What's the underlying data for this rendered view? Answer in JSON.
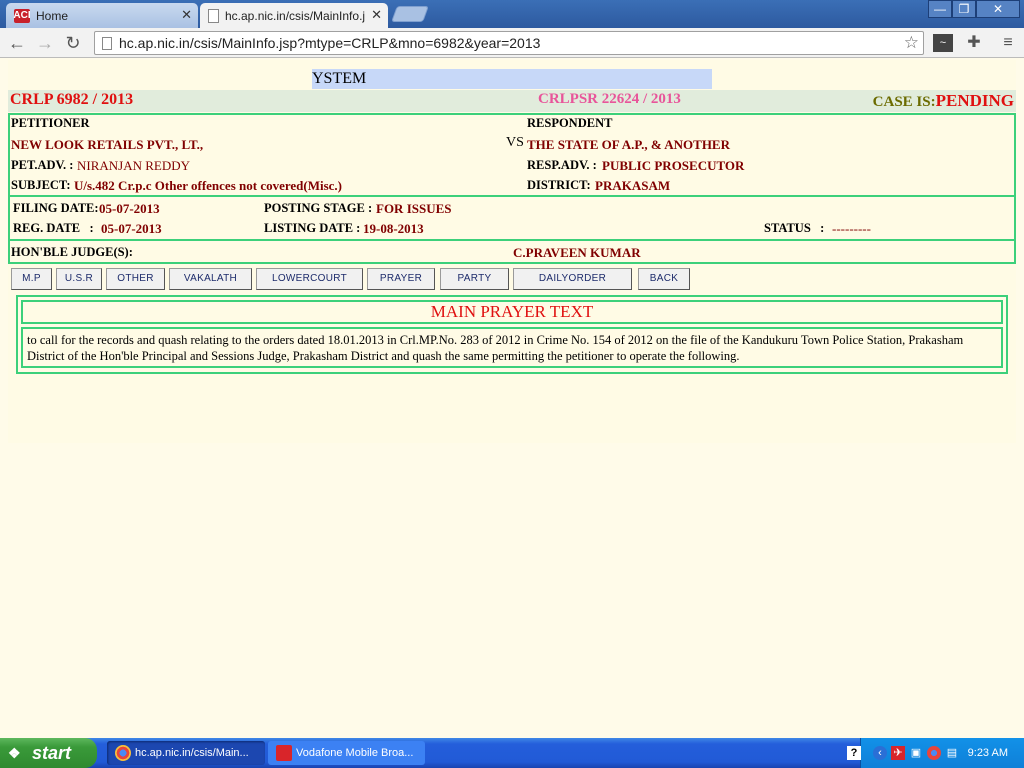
{
  "browser": {
    "tabs": [
      {
        "label": "Home"
      },
      {
        "label": "hc.ap.nic.in/csis/MainInfo.jsp"
      }
    ],
    "url": "hc.ap.nic.in/csis/MainInfo.jsp?mtype=CRLP&mno=6982&year=2013",
    "ext1_label": "~"
  },
  "page": {
    "banner": "YSTEM",
    "case_no": "CRLP 6982 / 2013",
    "crlpsr": "CRLPSR 22624 / 2013",
    "case_status_label": "CASE IS:",
    "case_status_value": "PENDING",
    "petitioner_label": "PETITIONER",
    "petitioner": "NEW LOOK RETAILS PVT., LT.,",
    "vs": "VS",
    "respondent_label": "RESPONDENT",
    "respondent": "THE STATE OF A.P., & ANOTHER",
    "pet_adv_label": "PET.ADV. :",
    "pet_adv": "NIRANJAN REDDY",
    "resp_adv_label": "RESP.ADV. :",
    "resp_adv": "PUBLIC PROSECUTOR",
    "subject_label": "SUBJECT:",
    "subject": "U/s.482 Cr.p.c Other offences not covered(Misc.)",
    "district_label": "DISTRICT:",
    "district": "PRAKASAM",
    "filing_date_label": "FILING DATE:",
    "filing_date": "05-07-2013",
    "posting_stage_label": "POSTING STAGE :",
    "posting_stage": "FOR ISSUES",
    "reg_date_label": "REG. DATE   :",
    "reg_date": "05-07-2013",
    "listing_date_label": "LISTING DATE :",
    "listing_date": "19-08-2013",
    "status_label": "STATUS   :",
    "status": "---------",
    "judges_label": "HON'BLE JUDGE(S):",
    "judge": "C.PRAVEEN KUMAR",
    "buttons": [
      "M.P",
      "U.S.R",
      "OTHER",
      "VAKALATH",
      "LOWERCOURT",
      "PRAYER",
      "PARTY",
      "DAILYORDER",
      "BACK"
    ],
    "prayer_title": "MAIN PRAYER TEXT",
    "prayer_text": "to call for the records and quash relating to the orders dated 18.01.2013 in Crl.MP.No. 283 of 2012 in Crime No. 154 of 2012 on the file of the Kandukuru Town Police Station, Prakasham District of the Hon'ble Principal and Sessions Judge, Prakasham District and quash the same permitting the petitioner to operate the following."
  },
  "taskbar": {
    "start": "start",
    "tasks": [
      {
        "label": "hc.ap.nic.in/csis/Main..."
      },
      {
        "label": "Vodafone Mobile Broa..."
      }
    ],
    "clock": "9:23 AM"
  },
  "colors": {
    "accent_red": "#e01010",
    "border_green": "#3cd07a",
    "value_maroon": "#800000"
  }
}
